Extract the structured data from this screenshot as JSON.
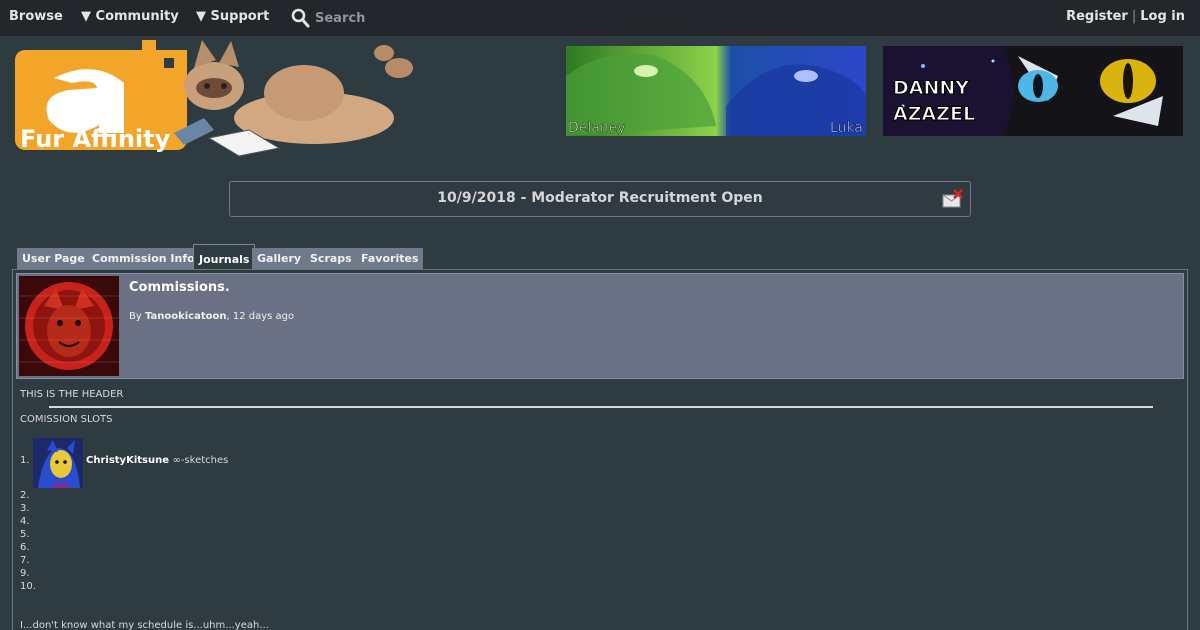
{
  "nav": {
    "browse": "Browse",
    "community": "▼ Community",
    "support": "▼ Support",
    "search": "Search",
    "register": "Register",
    "separator": "|",
    "login": "Log in"
  },
  "logo": {
    "text": "Fur Affinity"
  },
  "banners": [
    {
      "left_name": "Delaney",
      "right_name": "Luka"
    },
    {
      "line1": "DANNY",
      "line2": "AZAZEL"
    }
  ],
  "notice": {
    "text": "10/9/2018 - Moderator Recruitment Open"
  },
  "tabs": [
    {
      "label": "User Page"
    },
    {
      "label": "Commission Info"
    },
    {
      "label": "Journals",
      "active": true
    },
    {
      "label": "Gallery"
    },
    {
      "label": "Scraps"
    },
    {
      "label": "Favorites"
    }
  ],
  "journal": {
    "title": "Commissions.",
    "by": "By",
    "author": "Tanookicatoon",
    "time": ", 12 days ago",
    "body": {
      "header": "THIS IS THE HEADER",
      "slots_title": "COMISSION SLOTS",
      "slots": [
        {
          "num": "1.",
          "user": "ChristyKitsune",
          "note": "∞-sketches"
        },
        {
          "num": "2."
        },
        {
          "num": "3."
        },
        {
          "num": "4."
        },
        {
          "num": "5."
        },
        {
          "num": "6."
        },
        {
          "num": "7."
        },
        {
          "num": "9."
        },
        {
          "num": "10."
        }
      ],
      "footer": "I...don't know what my schedule is...uhm...yeah..."
    }
  },
  "colors": {
    "page_bg": "#2e3b41",
    "nav_bg": "#23262b",
    "tab_bg": "#6f7a8a",
    "journal_head_bg": "#6b7185"
  },
  "icons": {
    "search": "magnifier-icon",
    "notice_close": "dismiss-icon"
  }
}
